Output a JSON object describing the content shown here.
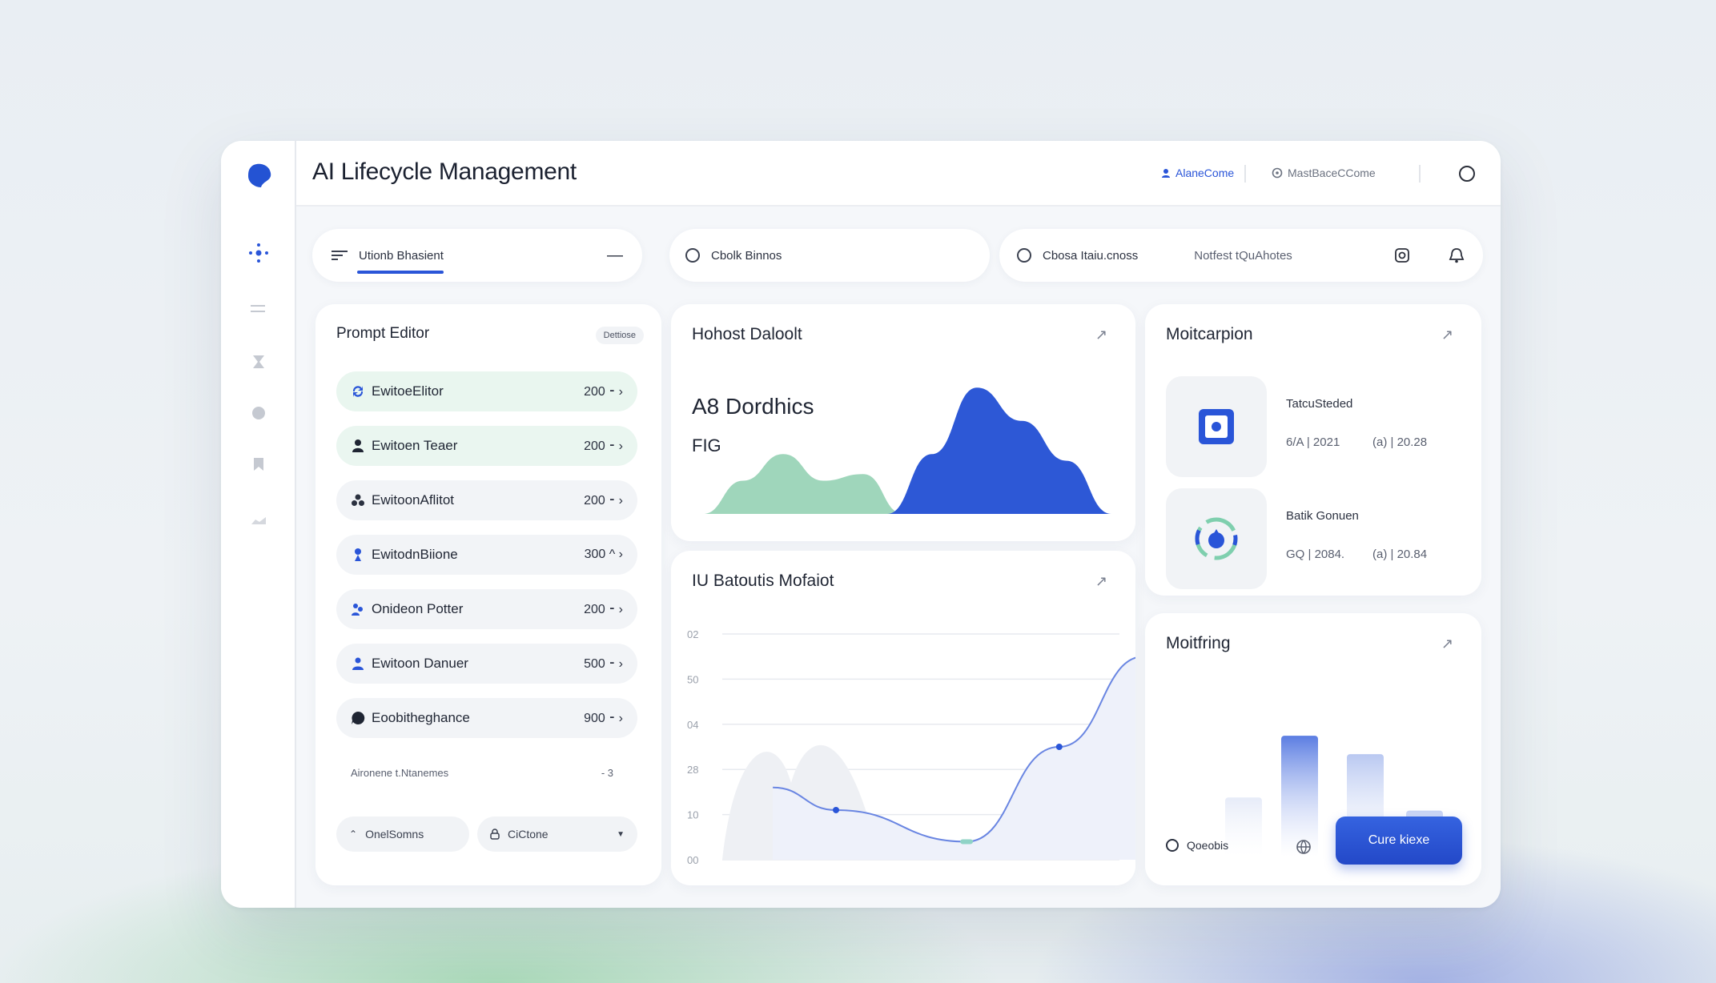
{
  "app": {
    "title": "AI Lifecycle Management"
  },
  "topbar": {
    "link_primary": "AlaneCome",
    "link_secondary": "MastBaceCCome"
  },
  "filters": {
    "pill1_label": "Utionb Bhasient",
    "pill1_action": "—",
    "pill2_label": "Cbolk Binnos",
    "pill3_label": "Cbosa Itaiu.cnoss",
    "pill3_secondary": "Notfest tQuAhotes"
  },
  "prompt_editor": {
    "title": "Prompt Editor",
    "badge": "Dettiose",
    "rows": [
      {
        "label": "EwitoeElitor",
        "value": "200 ⁃ ›"
      },
      {
        "label": "Ewitoen Teaer",
        "value": "200 ⁃ ›"
      },
      {
        "label": "EwitoonAflitot",
        "value": "200 ⁃ ›"
      },
      {
        "label": "EwitodnBiione",
        "value": "300 ^ ›"
      },
      {
        "label": "Onideon Potter",
        "value": "200 ⁃ ›"
      },
      {
        "label": "Ewitoon Danuer",
        "value": "500 ⁃ ›"
      },
      {
        "label": "Eoobitheghance",
        "value": "900 ⁃ ›"
      }
    ],
    "footer_label": "Aironene t.Ntanemes",
    "footer_value": "- 3",
    "btn_left": "OnelSomns",
    "btn_right": "CiCtone"
  },
  "hohost": {
    "title": "Hohost Daloolt",
    "metric_main": "A8 Dordhics",
    "metric_sub": "FIG",
    "chart_data": {
      "type": "area",
      "series": [
        {
          "values": [
            0.0,
            0.25,
            0.45,
            0.25,
            0.3,
            0.0
          ]
        },
        {
          "values": [
            0.0,
            0.45,
            0.95,
            0.7,
            0.4,
            0.0
          ]
        }
      ],
      "colors": [
        "#9fd6bb",
        "#2d58d6"
      ]
    }
  },
  "iu": {
    "title": "IU Batoutis Mofaiot",
    "chart_data": {
      "type": "line",
      "yticks": [
        "02",
        "50",
        "04",
        "28",
        "10",
        "00"
      ],
      "points": [
        {
          "x": 0.12,
          "y": 0.32
        },
        {
          "x": 0.27,
          "y": 0.22
        },
        {
          "x": 0.58,
          "y": 0.08
        },
        {
          "x": 0.8,
          "y": 0.5
        },
        {
          "x": 1.0,
          "y": 0.9
        }
      ],
      "color": "#6a86e2"
    }
  },
  "moitcarpion": {
    "title": "Moitcarpion",
    "item1_title": "TatcuSteded",
    "item1_meta_left": "6/A | 2021",
    "item1_meta_right": "(a) | 20.28",
    "item2_title": "Batik Gonuen",
    "item2_meta_left": "GQ | 2084.",
    "item2_meta_right": "(a) | 20.84"
  },
  "moitfring": {
    "title": "Moitfring",
    "radio_label": "Qoeobis",
    "cta_label": "Cure kiexe",
    "chart_data": {
      "type": "bar",
      "values": [
        0.45,
        0.92,
        0.78,
        0.35
      ],
      "colors": [
        "#e6ebf8",
        "#5b7de2",
        "#b9c8f1",
        "#c6d2f4"
      ]
    }
  },
  "colors": {
    "accent": "#2a55d8",
    "accent_light": "#e8f6ef",
    "text": "#1f2533"
  }
}
